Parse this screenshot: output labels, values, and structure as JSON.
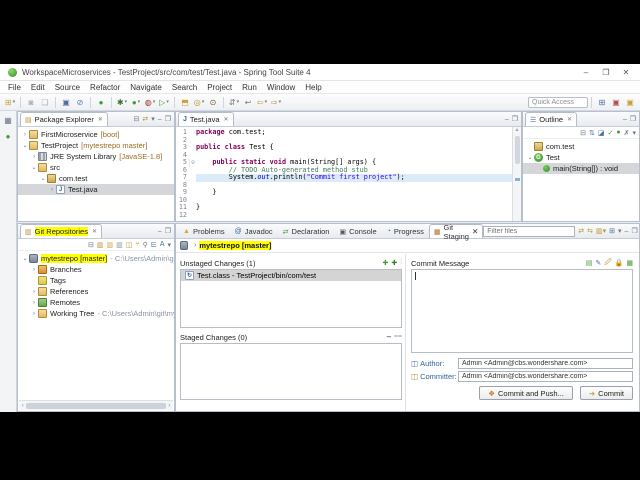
{
  "titlebar": {
    "title": "WorkspaceMicroservices - TestProject/src/com/test/Test.java - Spring Tool Suite 4",
    "minimize": "–",
    "maximize": "❐",
    "close": "✕"
  },
  "menubar": {
    "items": [
      "File",
      "Edit",
      "Source",
      "Refactor",
      "Navigate",
      "Search",
      "Project",
      "Run",
      "Window",
      "Help"
    ]
  },
  "toolbar": {
    "quick_access_label": "Quick Access",
    "icons": [
      {
        "name": "new-wizard-icon",
        "glyph": "⊞",
        "color": "#c9a23c",
        "dd": true
      },
      {
        "sep": true
      },
      {
        "name": "save-icon",
        "glyph": "◙",
        "color": "#aab0b8"
      },
      {
        "name": "save-all-icon",
        "glyph": "❏",
        "color": "#aab0b8"
      },
      {
        "sep": true
      },
      {
        "name": "open-console-icon",
        "glyph": "▣",
        "color": "#4e6f9e"
      },
      {
        "name": "skip-breakpoints-icon",
        "glyph": "⊘",
        "color": "#5b7fb4"
      },
      {
        "sep": true
      },
      {
        "name": "boot-dashboard-icon",
        "glyph": "●",
        "color": "#3f9c35"
      },
      {
        "sep": true
      },
      {
        "name": "debug-icon",
        "glyph": "✱",
        "color": "#356f2e",
        "dd": true
      },
      {
        "name": "run-icon",
        "glyph": "●",
        "color": "#3f9c35",
        "dd": true
      },
      {
        "name": "coverage-icon",
        "glyph": "◍",
        "color": "#a03030",
        "dd": true
      },
      {
        "name": "external-tools-icon",
        "glyph": "▷",
        "color": "#3f9c35",
        "dd": true
      },
      {
        "sep": true
      },
      {
        "name": "new-java-project-icon",
        "glyph": "⬒",
        "color": "#c9a23c"
      },
      {
        "name": "open-type-icon",
        "glyph": "◎",
        "color": "#b8912f",
        "dd": true
      },
      {
        "name": "search-icon",
        "glyph": "⊙",
        "color": "#6b5b1e"
      },
      {
        "sep": true
      },
      {
        "name": "annotations-icon",
        "glyph": "⇵",
        "color": "#777777",
        "dd": true
      },
      {
        "name": "last-edit-icon",
        "glyph": "↩",
        "color": "#777777"
      },
      {
        "name": "back-icon",
        "glyph": "⇦",
        "color": "#b8912f",
        "dd": true
      },
      {
        "name": "forward-icon",
        "glyph": "⇨",
        "color": "#b8912f",
        "dd": true
      }
    ],
    "perspective_icons": [
      {
        "name": "open-perspective-icon",
        "glyph": "⊞",
        "color": "#4e6f9e"
      },
      {
        "name": "java-perspective-icon",
        "glyph": "▣",
        "color": "#b05050"
      },
      {
        "name": "git-perspective-icon",
        "glyph": "▣",
        "color": "#c9a23c"
      }
    ]
  },
  "left_strip": {
    "icons": [
      {
        "name": "restore-views-icon",
        "glyph": "▦",
        "color": "#6b7586"
      },
      {
        "name": "boot-dashboard-mini-icon",
        "glyph": "●",
        "color": "#3f9c35"
      }
    ]
  },
  "package_explorer": {
    "tab_label": "Package Explorer",
    "tab_icon_glyph": "▤",
    "close_glyph": "✕",
    "tools": [
      {
        "name": "collapse-all-icon",
        "glyph": "⊟",
        "color": "#6b7586"
      },
      {
        "name": "link-with-editor-icon",
        "glyph": "⇄",
        "color": "#b8912f"
      },
      {
        "name": "view-menu-icon",
        "glyph": "▾",
        "color": "#6b7586"
      },
      {
        "name": "minimize-icon",
        "glyph": "–",
        "color": "#6b7586"
      },
      {
        "name": "maximize-icon",
        "glyph": "❐",
        "color": "#6b7586"
      }
    ],
    "tree": [
      {
        "depth": 0,
        "expander": "›",
        "icon": "boot-project",
        "label": "FirstMicroservice",
        "decoration": "[boot]"
      },
      {
        "depth": 0,
        "expander": "⌄",
        "icon": "project",
        "label": "TestProject",
        "decoration": "[mytestrepo master]"
      },
      {
        "depth": 1,
        "expander": "›",
        "icon": "library",
        "label": "JRE System Library",
        "decoration": "[JavaSE-1.8]"
      },
      {
        "depth": 1,
        "expander": "⌄",
        "icon": "src-folder",
        "label": "src"
      },
      {
        "depth": 2,
        "expander": "⌄",
        "icon": "package",
        "label": "com.test"
      },
      {
        "depth": 3,
        "expander": "›",
        "icon": "java-file",
        "iconletter": "J",
        "label": "Test.java",
        "selected": true
      }
    ]
  },
  "editor": {
    "tab_label": "Test.java",
    "tab_icon_glyph": "J",
    "close_glyph": "✕",
    "minimize_glyph": "–",
    "maximize_glyph": "❐",
    "lines": [
      {
        "n": "1",
        "segs": [
          {
            "t": "package",
            "s": "kw"
          },
          {
            "t": " com.test;",
            "s": "p"
          }
        ]
      },
      {
        "n": "2",
        "segs": []
      },
      {
        "n": "3",
        "segs": [
          {
            "t": "public class",
            "s": "kw"
          },
          {
            "t": " Test {",
            "s": "p"
          }
        ]
      },
      {
        "n": "4",
        "segs": []
      },
      {
        "n": "5",
        "fold": true,
        "segs": [
          {
            "t": "    ",
            "s": "p"
          },
          {
            "t": "public static void",
            "s": "kw"
          },
          {
            "t": " main(String[] args) {",
            "s": "p"
          }
        ]
      },
      {
        "n": "6",
        "segs": [
          {
            "t": "        // TODO Auto-generated method stub",
            "s": "c"
          }
        ]
      },
      {
        "n": "7",
        "hl": true,
        "segs": [
          {
            "t": "        System.",
            "s": "p"
          },
          {
            "t": "out",
            "s": "st"
          },
          {
            "t": ".println(",
            "s": "p"
          },
          {
            "t": "\"Commit first project\"",
            "s": "str"
          },
          {
            "t": ");",
            "s": "p"
          }
        ]
      },
      {
        "n": "8",
        "segs": []
      },
      {
        "n": "9",
        "segs": [
          {
            "t": "    }",
            "s": "p"
          }
        ]
      },
      {
        "n": "10",
        "segs": []
      },
      {
        "n": "11",
        "segs": [
          {
            "t": "}",
            "s": "p"
          }
        ]
      },
      {
        "n": "12",
        "segs": []
      }
    ]
  },
  "outline": {
    "tab_label": "Outline",
    "tab_icon_glyph": "☰",
    "close_glyph": "✕",
    "minimize_glyph": "–",
    "maximize_glyph": "❐",
    "tools": [
      {
        "name": "focus-icon",
        "glyph": "⊟",
        "color": "#6b7586"
      },
      {
        "name": "sort-icon",
        "glyph": "⇅",
        "color": "#4e6f9e"
      },
      {
        "name": "hide-fields-icon",
        "glyph": "◪",
        "color": "#4e6f9e"
      },
      {
        "name": "hide-static-icon",
        "glyph": "✓",
        "color": "#3f9c35"
      },
      {
        "name": "hide-non-public-icon",
        "glyph": "●",
        "color": "#3f9c35"
      },
      {
        "name": "hide-local-types-icon",
        "glyph": "✗",
        "color": "#777777"
      },
      {
        "name": "outline-menu-icon",
        "glyph": "▾",
        "color": "#6b7586"
      }
    ],
    "tree": [
      {
        "depth": 0,
        "icon": "package",
        "label": "com.test"
      },
      {
        "depth": 0,
        "expander": "⌄",
        "icon": "class",
        "iconletter": "G",
        "label": "Test"
      },
      {
        "depth": 1,
        "icon": "method",
        "label": "main(String[]) : void",
        "selected": true
      }
    ]
  },
  "git_repositories": {
    "tab_label": "Git Repositories",
    "tab_icon_glyph": "▥",
    "close_glyph": "✕",
    "minimize_glyph": "–",
    "maximize_glyph": "❐",
    "tools": [
      {
        "name": "collapse-all-icon",
        "glyph": "⊟",
        "color": "#6b7586"
      },
      {
        "name": "add-repository-icon",
        "glyph": "▥",
        "color": "#b8912f"
      },
      {
        "name": "clone-repository-icon",
        "glyph": "▥",
        "color": "#c9a23c"
      },
      {
        "name": "create-repository-icon",
        "glyph": "▥",
        "color": "#8a93a0"
      },
      {
        "name": "new-repo-icon",
        "glyph": "◫",
        "color": "#b8912f"
      },
      {
        "name": "branch-hierarchy-icon",
        "glyph": "⑂",
        "color": "#b8912f"
      },
      {
        "name": "toggle-layout-icon",
        "glyph": "⚲",
        "color": "#777777"
      },
      {
        "name": "hierarchy-icon",
        "glyph": "⋿",
        "color": "#4e6f9e"
      },
      {
        "name": "link-selection-icon",
        "glyph": "A",
        "color": "#4e6f9e"
      },
      {
        "name": "repos-menu-icon",
        "glyph": "▾",
        "color": "#6b7586"
      }
    ],
    "tree": [
      {
        "depth": 0,
        "expander": "⌄",
        "icon": "repo",
        "label": "mytestrepo [master]",
        "hl": true,
        "decoration": "- C:\\Users\\Admin\\git\\mytestr",
        "decoration_gray": true
      },
      {
        "depth": 1,
        "expander": "›",
        "icon": "branches",
        "label": "Branches"
      },
      {
        "depth": 1,
        "expander": "",
        "icon": "tags",
        "label": "Tags"
      },
      {
        "depth": 1,
        "expander": "›",
        "icon": "refs",
        "label": "References"
      },
      {
        "depth": 1,
        "expander": "›",
        "icon": "remotes",
        "label": "Remotes"
      },
      {
        "depth": 1,
        "expander": "›",
        "icon": "worktree",
        "label": "Working Tree",
        "decoration": "- C:\\Users\\Admin\\git\\mytestrepo",
        "decoration_gray": true
      }
    ]
  },
  "bottom_tabs": [
    {
      "label": "Problems",
      "icon": "problems-icon",
      "glyph": "▲",
      "color": "#d9a441"
    },
    {
      "label": "Javadoc",
      "icon": "javadoc-icon",
      "glyph": "@",
      "color": "#3465a4"
    },
    {
      "label": "Declaration",
      "icon": "declaration-icon",
      "glyph": "⇄",
      "color": "#3f9c35"
    },
    {
      "label": "Console",
      "icon": "console-icon",
      "glyph": "▣",
      "color": "#555555"
    },
    {
      "label": "Progress",
      "icon": "progress-icon",
      "glyph": "◔",
      "color": "#3465a4"
    },
    {
      "label": "Git Staging",
      "icon": "git-staging-icon",
      "glyph": "▦",
      "color": "#b0671f",
      "active": true
    }
  ],
  "git_staging": {
    "filter_placeholder": "Filter files",
    "header_tools": [
      {
        "name": "link-with-selection-icon",
        "glyph": "⇄",
        "color": "#b8912f"
      },
      {
        "name": "link-with-editor-icon",
        "glyph": "⇆",
        "color": "#b8912f"
      },
      {
        "name": "repo-switch-icon",
        "glyph": "▥",
        "color": "#b8912f",
        "dd": true
      },
      {
        "name": "switch-repositories-icon",
        "glyph": "⊞",
        "color": "#4e6f9e"
      },
      {
        "name": "staging-menu-icon",
        "glyph": "▾",
        "color": "#6b7586"
      },
      {
        "name": "minimize-icon",
        "glyph": "–",
        "color": "#6b7586"
      },
      {
        "name": "maximize-icon",
        "glyph": "❐",
        "color": "#6b7586"
      }
    ],
    "repo_icon_glyph": "▯",
    "crumb_sep": "›",
    "repo_label": "mytestrepo [master]",
    "unstaged": {
      "title": "Unstaged Changes (1)",
      "tools": [
        {
          "name": "stage-selected-icon",
          "glyph": "✚",
          "color": "#3f9c35"
        },
        {
          "name": "stage-all-icon",
          "glyph": "✚",
          "color": "#2f7f28"
        },
        {
          "name": "compact-tree-icon",
          "glyph": "⫶",
          "color": "#6b7586"
        }
      ],
      "items": [
        {
          "label": "Test.class - TestProject/bin/com/test",
          "icon_glyph": "↻",
          "selected": true
        }
      ]
    },
    "staged": {
      "title": "Staged Changes (0)",
      "tools": [
        {
          "name": "unstage-selected-icon",
          "glyph": "━",
          "color": "#8a93a0"
        },
        {
          "name": "unstage-all-icon",
          "glyph": "⩵",
          "color": "#8a93a0"
        }
      ],
      "items": []
    },
    "commit_message_title": "Commit Message",
    "commit_tools": [
      {
        "name": "preview-icon",
        "glyph": "▤",
        "color": "#3f9c35"
      },
      {
        "name": "amend-icon",
        "glyph": "✎",
        "color": "#4e6f9e"
      },
      {
        "name": "sign-off-icon",
        "glyph": "🖉",
        "color": "#b8912f"
      },
      {
        "name": "signed-commit-icon",
        "glyph": "🔒",
        "color": "#c9a23c"
      },
      {
        "name": "change-id-icon",
        "glyph": "▦",
        "color": "#3f9c35"
      }
    ],
    "author_label": "Author:",
    "author_value": "Admin <Admin@cbs.wondershare.com>",
    "committer_label": "Committer:",
    "committer_value": "Admin <Admin@cbs.wondershare.com>",
    "author_icon_glyph": "◫",
    "committer_icon_glyph": "◫",
    "commit_push_button": "Commit and Push...",
    "commit_push_icon_glyph": "❖",
    "commit_button": "Commit",
    "commit_icon_glyph": "➜"
  }
}
